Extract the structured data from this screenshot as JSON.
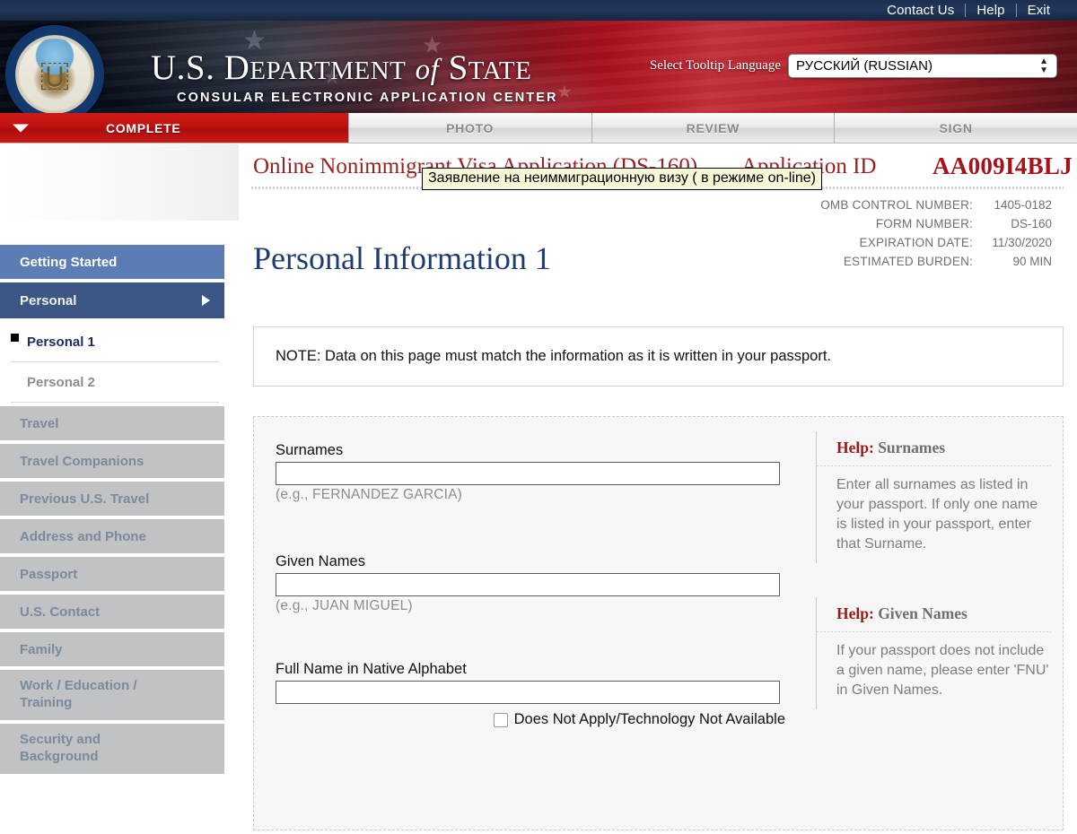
{
  "topbar": {
    "links": [
      "Contact Us",
      "Help",
      "Exit"
    ]
  },
  "banner": {
    "agency_line1_a": "U.S. ",
    "agency_line1_b": "D",
    "agency_line1_c": "EPARTMENT",
    "agency_line1_d": "of",
    "agency_line1_e": "S",
    "agency_line1_f": "TATE",
    "agency_line2": "CONSULAR ELECTRONIC APPLICATION CENTER",
    "language_label": "Select Tooltip Language",
    "language_value": "РУССКИЙ (RUSSIAN)"
  },
  "steps": [
    {
      "label": "COMPLETE",
      "active": true
    },
    {
      "label": "PHOTO",
      "active": false
    },
    {
      "label": "REVIEW",
      "active": false
    },
    {
      "label": "SIGN",
      "active": false
    }
  ],
  "sidebar": {
    "items": [
      {
        "label": "Getting Started",
        "state": "section-active"
      },
      {
        "label": "Personal",
        "state": "section-open"
      },
      {
        "label": "Personal 1",
        "state": "sub-current"
      },
      {
        "label": "Personal 2",
        "state": "sub"
      },
      {
        "label": "Travel",
        "state": "section-dim"
      },
      {
        "label": "Travel Companions",
        "state": "section-dim"
      },
      {
        "label": "Previous U.S. Travel",
        "state": "section-dim"
      },
      {
        "label": "Address and Phone",
        "state": "section-dim"
      },
      {
        "label": "Passport",
        "state": "section-dim"
      },
      {
        "label": "U.S. Contact",
        "state": "section-dim"
      },
      {
        "label": "Family",
        "state": "section-dim"
      },
      {
        "label": "Work / Education /",
        "label2": "Training",
        "state": "section-dim"
      },
      {
        "label": "Security and",
        "label2": "Background",
        "state": "section-dim"
      }
    ],
    "work_line1": "Work / Education /",
    "work_line2": "Training",
    "security_line1": "Security and",
    "security_line2": "Background"
  },
  "main": {
    "app_title": "Online Nonimmigrant Visa Application (DS-160)",
    "app_id_label": "Application ID",
    "app_id_value": "AA009I4BLJ",
    "tooltip_text": "Заявление на неиммиграционную визу ( в режиме on-line)",
    "page_heading": "Personal Information 1",
    "meta": [
      {
        "key": "OMB CONTROL NUMBER:",
        "value": "1405-0182"
      },
      {
        "key": "FORM NUMBER:",
        "value": "DS-160"
      },
      {
        "key": "EXPIRATION DATE:",
        "value": "11/30/2020"
      },
      {
        "key": "ESTIMATED BURDEN:",
        "value": "90 MIN"
      }
    ],
    "note": "NOTE: Data on this page must match the information as it is written in your passport."
  },
  "form": {
    "surnames": {
      "label": "Surnames",
      "value": "",
      "hint": "(e.g., FERNANDEZ GARCIA)"
    },
    "given_names": {
      "label": "Given Names",
      "value": "",
      "hint": "(e.g., JUAN MIGUEL)"
    },
    "native_name": {
      "label": "Full Name in Native Alphabet",
      "value": "",
      "checkbox_label": "Does Not Apply/Technology Not Available",
      "checked": false
    }
  },
  "help": [
    {
      "word": "Help:",
      "topic": " Surnames",
      "body": "Enter all surnames as listed in your passport. If only one name is listed in your passport, enter that Surname."
    },
    {
      "word": "Help:",
      "topic": " Given Names",
      "body": "If your passport does not include a given name, please enter 'FNU' in Given Names."
    }
  ],
  "colors": {
    "brand_red": "#a51219",
    "nav_blue": "#3c5685",
    "nav_blue_light": "#5b7cb4",
    "heading_blue": "#1f3b73",
    "tab_red": "#c01110"
  }
}
